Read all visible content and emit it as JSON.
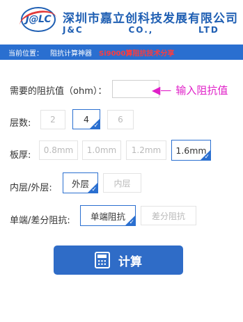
{
  "header": {
    "logo_text": "J@LC",
    "company_cn": "深圳市嘉立创科技发展有限公司",
    "company_en": "J&C    CO.,    LTD"
  },
  "nav": {
    "label": "当前位置：",
    "current": "阻抗计算神器",
    "link": "Si9000算阻抗技术分享",
    "bg_color": "#2a6fd0",
    "link_color": "#ff3b3b"
  },
  "impedance": {
    "label": "需要的阻抗值（ohm）：",
    "value": "",
    "hint_arrow": "arrow-left-icon",
    "hint_text": "输入阻抗值"
  },
  "layers": {
    "label": "层数:",
    "options": [
      "2",
      "4",
      "6"
    ],
    "selected": "4"
  },
  "thickness": {
    "label": "板厚:",
    "options": [
      "0.8mm",
      "1.0mm",
      "1.2mm",
      "1.6mm"
    ],
    "selected": "1.6mm"
  },
  "layer_type": {
    "label": "内层/外层:",
    "options": [
      "外层",
      "内层"
    ],
    "selected": "外层"
  },
  "impedance_type": {
    "label": "单端/差分阻抗:",
    "options": [
      "单端阻抗",
      "差分阻抗"
    ],
    "selected": "单端阻抗"
  },
  "calculate": {
    "label": "计算",
    "icon": "calculator-icon",
    "color": "#2f6cc7"
  }
}
